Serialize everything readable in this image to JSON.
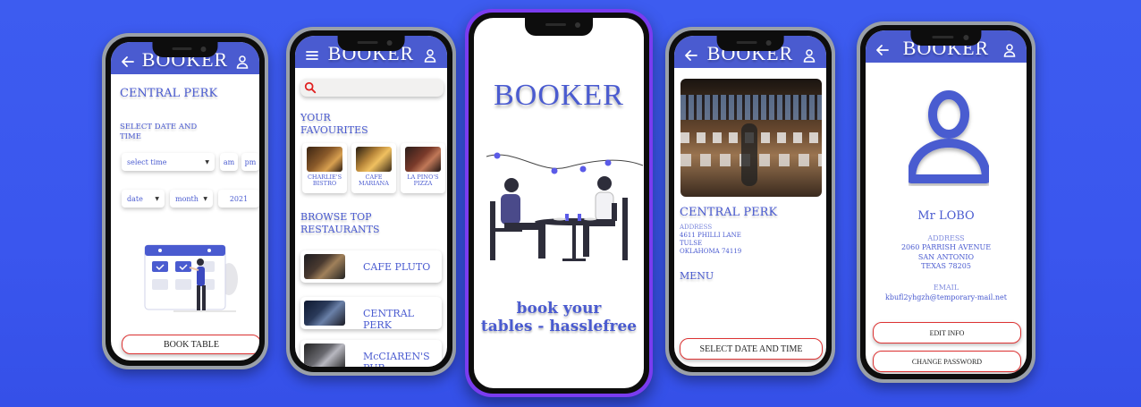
{
  "app_title": "BOOKER",
  "screen1": {
    "restaurant": "CENTRAL PERK",
    "select_label_1": "SELECT DATE AND",
    "select_label_2": "TIME",
    "time_placeholder": "select time",
    "am": "am",
    "pm": "pm",
    "date": "date",
    "month": "month",
    "year": "2021",
    "book_button": "BOOK TABLE"
  },
  "screen2": {
    "favourites_title_1": "YOUR",
    "favourites_title_2": "FAVOURITES",
    "favourites": [
      {
        "line1": "CHARLIE'S",
        "line2": "BISTRO"
      },
      {
        "line1": "CAFE",
        "line2": "MARIANA"
      },
      {
        "line1": "LA PINO'S",
        "line2": "PIZZA"
      }
    ],
    "browse_title_1": "BROWSE TOP",
    "browse_title_2": "RESTAURANTS",
    "restaurants": [
      "CAFE PLUTO",
      "CENTRAL PERK",
      "McCIAREN'S PUB"
    ]
  },
  "screen3": {
    "tagline_1": "book your",
    "tagline_2": "tables - hasslefree"
  },
  "screen4": {
    "restaurant": "CENTRAL PERK",
    "address_label": "ADDRESS",
    "address_1": "4611 PHILLI LANE",
    "address_2": "TULSE",
    "address_3": "OKLAHOMA 74119",
    "menu_label": "MENU",
    "select_button": "SELECT DATE AND TIME"
  },
  "screen5": {
    "name": "Mr LOBO",
    "address_label": "ADDRESS",
    "address_1": "2060 PARRISH AVENUE",
    "address_2": "SAN ANTONIO",
    "address_3": "TEXAS 78205",
    "email_label": "EMAIL",
    "email": "kbufl2yhgzh@temporary-mail.net",
    "edit_button": "EDIT INFO",
    "password_button": "CHANGE PASSWORD"
  },
  "colors": {
    "background": "#3d5cf0",
    "brand": "#4a5bd0",
    "button_border": "#dd3333"
  }
}
